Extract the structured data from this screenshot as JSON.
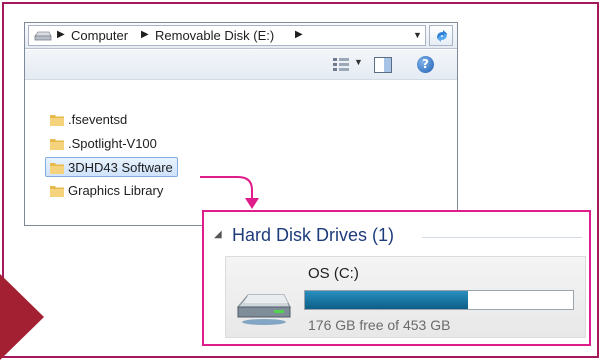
{
  "address": {
    "crumbs": [
      "Computer",
      "Removable Disk (E:)"
    ],
    "dropdown_icon": "chevron-down-icon",
    "refresh_icon": "refresh-icon"
  },
  "toolbar": {
    "views_icon": "views-icon",
    "preview_icon": "preview-pane-icon",
    "help_label": "?"
  },
  "files": [
    {
      "name": ".fseventsd",
      "selected": false
    },
    {
      "name": ".Spotlight-V100",
      "selected": false
    },
    {
      "name": "3DHD43 Software",
      "selected": true
    },
    {
      "name": "Graphics Library",
      "selected": false
    }
  ],
  "hdd": {
    "title": "Hard Disk Drives (1)",
    "drive": {
      "name": "OS (C:)",
      "free_text": "176 GB free of 453 GB",
      "used_fraction": 0.61
    }
  },
  "colors": {
    "frame": "#a3195b",
    "highlight": "#e01b8a",
    "arrow": "#a32033",
    "bar_fill": "#1c79a6"
  }
}
